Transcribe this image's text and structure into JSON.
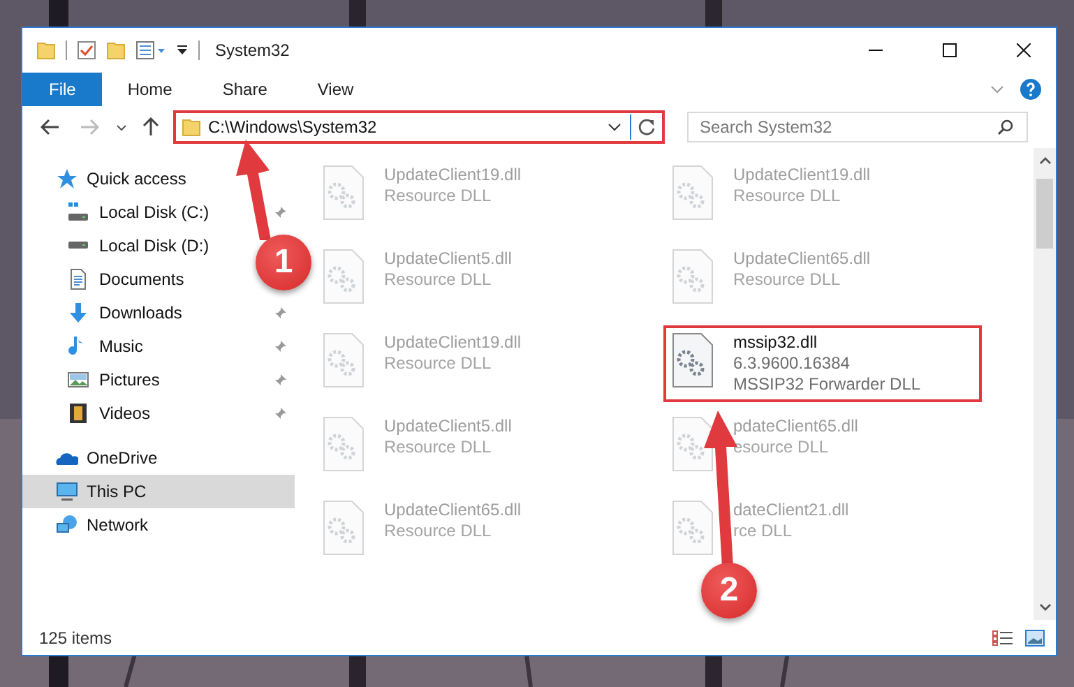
{
  "window": {
    "title": "System32"
  },
  "ribbon": {
    "tabs": [
      {
        "label": "File",
        "kind": "file"
      },
      {
        "label": "Home",
        "kind": "tab"
      },
      {
        "label": "Share",
        "kind": "tab"
      },
      {
        "label": "View",
        "kind": "tab"
      }
    ]
  },
  "address": {
    "path": "C:\\Windows\\System32",
    "highlighted": true
  },
  "search": {
    "placeholder": "Search System32"
  },
  "sidebar": {
    "items": [
      {
        "label": "Quick access",
        "kind": "star",
        "selected": false,
        "children": [
          {
            "label": "Local Disk (C:)",
            "kind": "disk-windows",
            "pinned": true,
            "selected": false
          },
          {
            "label": "Local Disk (D:)",
            "kind": "disk",
            "pinned": false,
            "selected": false
          },
          {
            "label": "Documents",
            "kind": "document",
            "pinned": false,
            "selected": false
          },
          {
            "label": "Downloads",
            "kind": "download",
            "pinned": true,
            "selected": false
          },
          {
            "label": "Music",
            "kind": "music",
            "pinned": true,
            "selected": false
          },
          {
            "label": "Pictures",
            "kind": "pictures",
            "pinned": true,
            "selected": false
          },
          {
            "label": "Videos",
            "kind": "videos",
            "pinned": true,
            "selected": false
          }
        ]
      },
      {
        "label": "OneDrive",
        "kind": "cloud",
        "selected": false
      },
      {
        "label": "This PC",
        "kind": "computer",
        "selected": true
      },
      {
        "label": "Network",
        "kind": "network",
        "selected": false
      }
    ]
  },
  "files": [
    {
      "name": "UpdateClient19.dll",
      "lines": [
        "Resource DLL"
      ],
      "blurred": true,
      "highlighted": false
    },
    {
      "name": "UpdateClient19.dll",
      "lines": [
        "Resource DLL"
      ],
      "blurred": true,
      "highlighted": false
    },
    {
      "name": "UpdateClient5.dll",
      "lines": [
        "Resource DLL"
      ],
      "blurred": true,
      "highlighted": false
    },
    {
      "name": "UpdateClient65.dll",
      "lines": [
        "Resource DLL"
      ],
      "blurred": true,
      "highlighted": false
    },
    {
      "name": "UpdateClient19.dll",
      "lines": [
        "Resource DLL"
      ],
      "blurred": true,
      "highlighted": false
    },
    {
      "name": "mssip32.dll",
      "lines": [
        "6.3.9600.16384",
        "MSSIP32 Forwarder DLL"
      ],
      "blurred": false,
      "highlighted": true
    },
    {
      "name": "UpdateClient5.dll",
      "lines": [
        "Resource DLL"
      ],
      "blurred": true,
      "highlighted": false
    },
    {
      "name": "pdateClient65.dll",
      "lines": [
        "esource DLL"
      ],
      "blurred": true,
      "highlighted": false
    },
    {
      "name": "UpdateClient65.dll",
      "lines": [
        "Resource DLL"
      ],
      "blurred": true,
      "highlighted": false
    },
    {
      "name": "dateClient21.dll",
      "lines": [
        "rce DLL"
      ],
      "blurred": true,
      "highlighted": false
    }
  ],
  "status_bar": {
    "count": "125 items"
  },
  "annotations": [
    {
      "number": "1"
    },
    {
      "number": "2"
    }
  ]
}
